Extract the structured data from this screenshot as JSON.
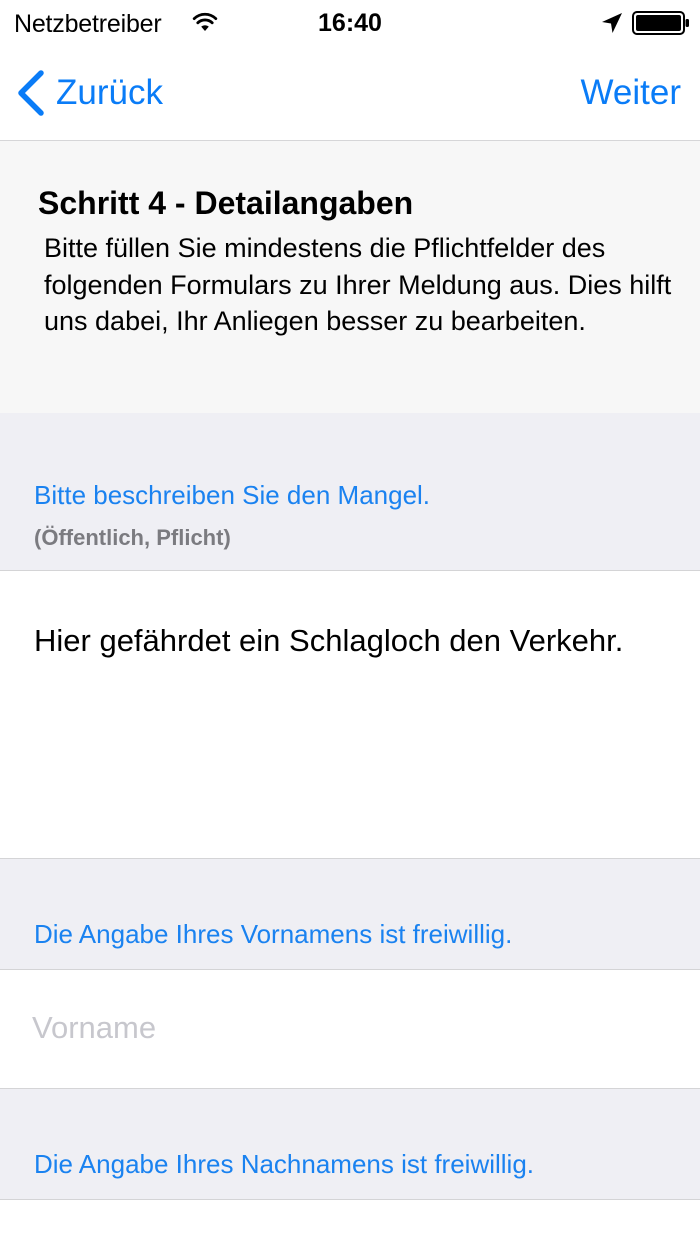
{
  "status_bar": {
    "carrier": "Netzbetreiber",
    "time": "16:40",
    "icons": [
      "wifi-icon",
      "location-arrow-icon",
      "battery-icon"
    ]
  },
  "nav": {
    "back_label": "Zurück",
    "next_label": "Weiter",
    "accent_color": "#0a7cf7"
  },
  "step": {
    "title": "Schritt 4 - Detailangaben",
    "description": "Bitte füllen Sie mindestens die Pflichtfelder des folgenden Formulars zu Ihrer Meldung aus. Dies hilft uns dabei, Ihr Anliegen besser zu bearbeiten."
  },
  "form": {
    "description_section": {
      "hint": "Bitte beschreiben Sie den Mangel.",
      "subhint": "(Öffentlich, Pflicht)",
      "value": "Hier gefährdet ein Schlagloch den Verkehr."
    },
    "first_name_section": {
      "hint": "Die Angabe Ihres Vornamens ist freiwillig.",
      "placeholder": "Vorname",
      "value": ""
    },
    "last_name_section": {
      "hint": "Die Angabe Ihres Nachnamens ist freiwillig."
    }
  }
}
